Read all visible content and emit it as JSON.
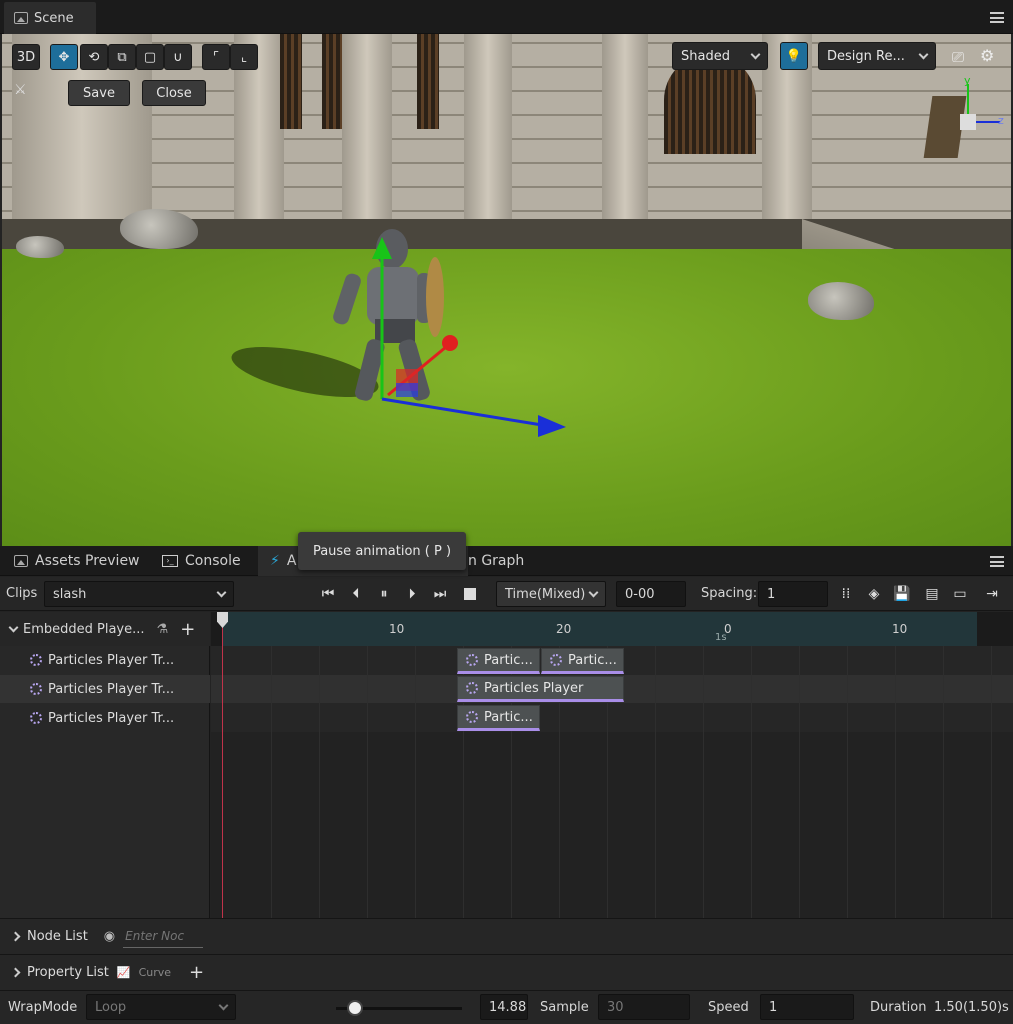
{
  "scene": {
    "tab_title": "Scene",
    "toolbar": {
      "mode_3d": "3D",
      "shading": "Shaded",
      "resolution": "Design Re..."
    },
    "edit": {
      "save": "Save",
      "close": "Close"
    },
    "gizmo": {
      "axis_y": "y",
      "axis_z": "z"
    }
  },
  "panel_tabs": {
    "assets_preview": "Assets Preview",
    "console": "Console",
    "animation_short": "A",
    "graph_tail": "n Graph"
  },
  "tooltip": "Pause animation ( P )",
  "animation_toolbar": {
    "clips_label": "Clips",
    "clip_value": "slash",
    "time_mode": "Time(Mixed)",
    "frame_value": "0-00",
    "spacing_label": "Spacing:",
    "spacing_value": "1"
  },
  "tracks": {
    "group": "Embedded Playe...",
    "items": [
      {
        "label": "Particles Player Tr..."
      },
      {
        "label": "Particles Player Tr..."
      },
      {
        "label": "Particles Player Tr..."
      }
    ]
  },
  "ruler": {
    "ticks": [
      "10",
      "20",
      "0",
      "10"
    ],
    "second_marker": "1s"
  },
  "clips": {
    "r1a": "Partic...",
    "r1b": "Partic...",
    "r2": "Particles Player",
    "r3": "Partic..."
  },
  "node_list": {
    "label": "Node List",
    "placeholder": "Enter Noc"
  },
  "property_list": {
    "label": "Property List",
    "curve": "Curve"
  },
  "bottom": {
    "wrapmode_label": "WrapMode",
    "wrapmode_value": "Loop",
    "slider_value": "14.88",
    "slider_fraction": 0.15,
    "sample_label": "Sample",
    "sample_value": "30",
    "speed_label": "Speed",
    "speed_value": "1",
    "duration_label": "Duration",
    "duration_value": "1.50(1.50)s"
  },
  "colors": {
    "accent": "#1e6e9a",
    "clip_border": "#a98ee8",
    "playhead": "#c0334a"
  }
}
